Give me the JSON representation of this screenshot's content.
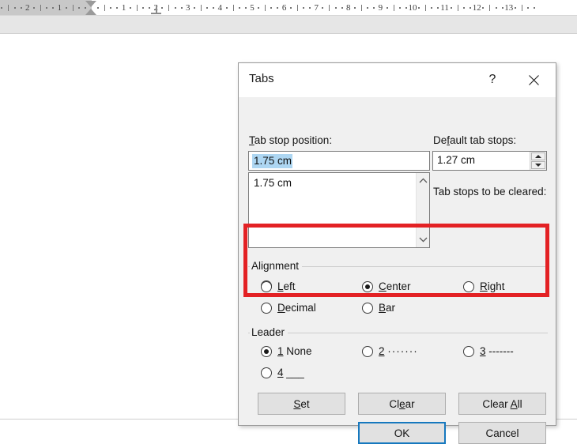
{
  "ruler": {
    "name": "horizontal-ruler",
    "left_labels": [
      "2",
      "1"
    ],
    "labels": [
      "1",
      "2",
      "3",
      "4",
      "5",
      "6",
      "7",
      "8",
      "9",
      "10",
      "11",
      "12",
      "13"
    ],
    "markers": {
      "first_line_indent": "indent-marker",
      "center_tab_stop": "center-tab-marker"
    }
  },
  "dialog": {
    "title": "Tabs",
    "help_label": "?",
    "close_label": "✕",
    "tab_stop_position": {
      "label": "Tab stop position:",
      "label_accel": "T",
      "value": "1.75 cm",
      "selected": true
    },
    "tab_stop_list": {
      "items": [
        "1.75 cm"
      ],
      "scroll_up": "∧",
      "scroll_down": "∨"
    },
    "default_tab_stops": {
      "label": "Default tab stops:",
      "label_accel": "f",
      "value": "1.27 cm"
    },
    "tab_stops_to_be_cleared": {
      "label": "Tab stops to be cleared:",
      "items": []
    },
    "alignment": {
      "title": "Alignment",
      "selected": "Center",
      "options": [
        {
          "label": "Left",
          "accel": "L",
          "checked": false
        },
        {
          "label": "Center",
          "accel": "C",
          "checked": true
        },
        {
          "label": "Right",
          "accel": "R",
          "checked": false
        },
        {
          "label": "Decimal",
          "accel": "D",
          "checked": false
        },
        {
          "label": "Bar",
          "accel": "B",
          "checked": false
        }
      ]
    },
    "leader": {
      "title": "Leader",
      "selected": "1 None",
      "options": [
        {
          "number": "1",
          "label": "None",
          "checked": true
        },
        {
          "number": "2",
          "label": "·······",
          "checked": false
        },
        {
          "number": "3",
          "label": "-------",
          "checked": false
        },
        {
          "number": "4",
          "label": "___",
          "checked": false
        }
      ]
    },
    "buttons": {
      "set": "Set",
      "clear": "Clear",
      "clear_all": "Clear All",
      "ok": "OK",
      "cancel": "Cancel"
    }
  },
  "annotation": {
    "highlight_color": "#e32124",
    "target": "Alignment"
  },
  "colors": {
    "dialog_bg": "#f0f0f0",
    "titlebar_bg": "#ffffff",
    "accent_focus": "#1678be",
    "selection_blue": "#add6f2",
    "highlight_red": "#e32124"
  }
}
